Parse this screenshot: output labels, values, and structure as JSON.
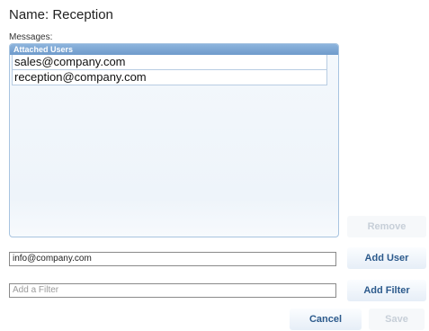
{
  "header": {
    "title": "Name: Reception"
  },
  "messages": {
    "label": "Messages:",
    "list_header": "Attached Users",
    "users": [
      "sales@company.com",
      "reception@company.com"
    ]
  },
  "buttons": {
    "remove": "Remove",
    "add_user": "Add User",
    "add_filter": "Add Filter",
    "cancel": "Cancel",
    "save": "Save"
  },
  "user_input": {
    "value": "info@company.com"
  },
  "filter_input": {
    "placeholder": "Add a Filter"
  },
  "colors": {
    "accent": "#6f9bcb",
    "button_text": "#2c5a8c",
    "disabled_text": "#c7cfd8"
  }
}
